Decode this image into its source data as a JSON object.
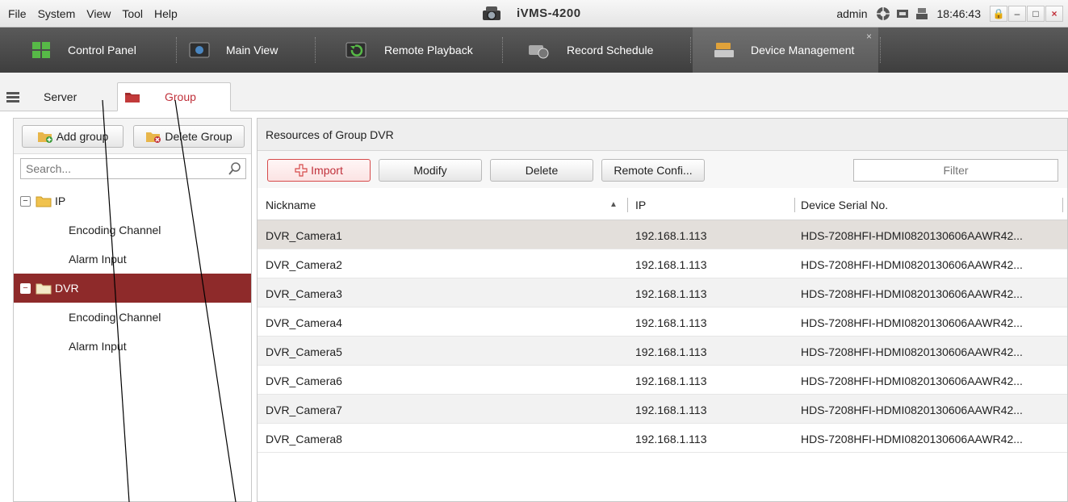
{
  "menu": [
    "File",
    "System",
    "View",
    "Tool",
    "Help"
  ],
  "app_title": "iVMS-4200",
  "tray": {
    "user": "admin",
    "time": "18:46:43"
  },
  "window_buttons": {
    "lock": "🔒",
    "minimize": "–",
    "maximize": "□",
    "close": "×"
  },
  "modules": [
    {
      "label": "Control Panel",
      "icon": "control-panel-icon"
    },
    {
      "label": "Main View",
      "icon": "main-view-icon"
    },
    {
      "label": "Remote Playback",
      "icon": "remote-playback-icon"
    },
    {
      "label": "Record Schedule",
      "icon": "record-schedule-icon"
    },
    {
      "label": "Device Management",
      "icon": "device-management-icon",
      "active": true
    }
  ],
  "module_close": "×",
  "subtabs": {
    "server": "Server",
    "group": "Group"
  },
  "left": {
    "add_group": "Add group",
    "delete_group": "Delete Group",
    "search_placeholder": "Search...",
    "tree": {
      "ip": {
        "toggle": "−",
        "label": "IP",
        "children": [
          "Encoding Channel",
          "Alarm Input"
        ]
      },
      "dvr": {
        "toggle": "−",
        "label": "DVR",
        "children": [
          "Encoding Channel",
          "Alarm Input"
        ]
      }
    }
  },
  "right": {
    "title": "Resources of Group DVR",
    "toolbar": {
      "import": "Import",
      "modify": "Modify",
      "delete": "Delete",
      "remote_config": "Remote Confi...",
      "filter_placeholder": "Filter"
    },
    "columns": {
      "nickname": "Nickname",
      "sort": "▲",
      "ip": "IP",
      "serial": "Device Serial No."
    },
    "rows": [
      {
        "nickname": "DVR_Camera1",
        "ip": "192.168.1.113",
        "serial": "HDS-7208HFI-HDMI0820130606AAWR42..."
      },
      {
        "nickname": "DVR_Camera2",
        "ip": "192.168.1.113",
        "serial": "HDS-7208HFI-HDMI0820130606AAWR42..."
      },
      {
        "nickname": "DVR_Camera3",
        "ip": "192.168.1.113",
        "serial": "HDS-7208HFI-HDMI0820130606AAWR42..."
      },
      {
        "nickname": "DVR_Camera4",
        "ip": "192.168.1.113",
        "serial": "HDS-7208HFI-HDMI0820130606AAWR42..."
      },
      {
        "nickname": "DVR_Camera5",
        "ip": "192.168.1.113",
        "serial": "HDS-7208HFI-HDMI0820130606AAWR42..."
      },
      {
        "nickname": "DVR_Camera6",
        "ip": "192.168.1.113",
        "serial": "HDS-7208HFI-HDMI0820130606AAWR42..."
      },
      {
        "nickname": "DVR_Camera7",
        "ip": "192.168.1.113",
        "serial": "HDS-7208HFI-HDMI0820130606AAWR42..."
      },
      {
        "nickname": "DVR_Camera8",
        "ip": "192.168.1.113",
        "serial": "HDS-7208HFI-HDMI0820130606AAWR42..."
      }
    ]
  },
  "colors": {
    "accent": "#c0303a",
    "selected_tree": "#8e2a2a",
    "module_bar": "#4a4a4a"
  }
}
